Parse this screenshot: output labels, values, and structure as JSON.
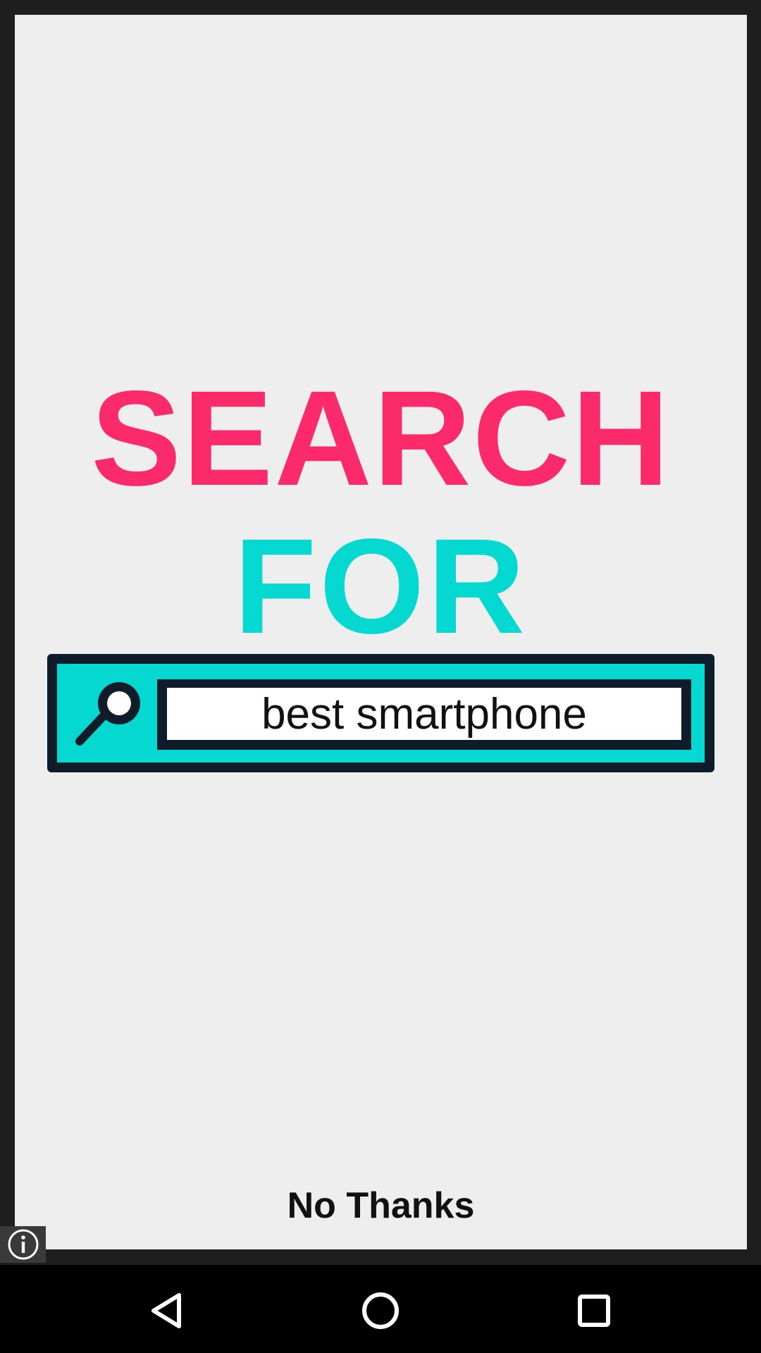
{
  "ad": {
    "headline_line1": "SEARCH",
    "headline_line2": "FOR",
    "search_query": "best smartphone",
    "dismiss_label": "No Thanks",
    "colors": {
      "headline_line1": "#fb2a6a",
      "headline_line2": "#05d8d0",
      "banner_frame": "#0f1c2a",
      "banner_fill": "#05d8d0",
      "background": "#eeeeee"
    },
    "icons": {
      "search": "magnifier-icon",
      "info": "info-icon"
    }
  },
  "navigation_bar": {
    "buttons": [
      {
        "name": "back",
        "icon": "back-triangle-icon"
      },
      {
        "name": "home",
        "icon": "home-circle-icon"
      },
      {
        "name": "recents",
        "icon": "recents-square-icon"
      }
    ]
  }
}
